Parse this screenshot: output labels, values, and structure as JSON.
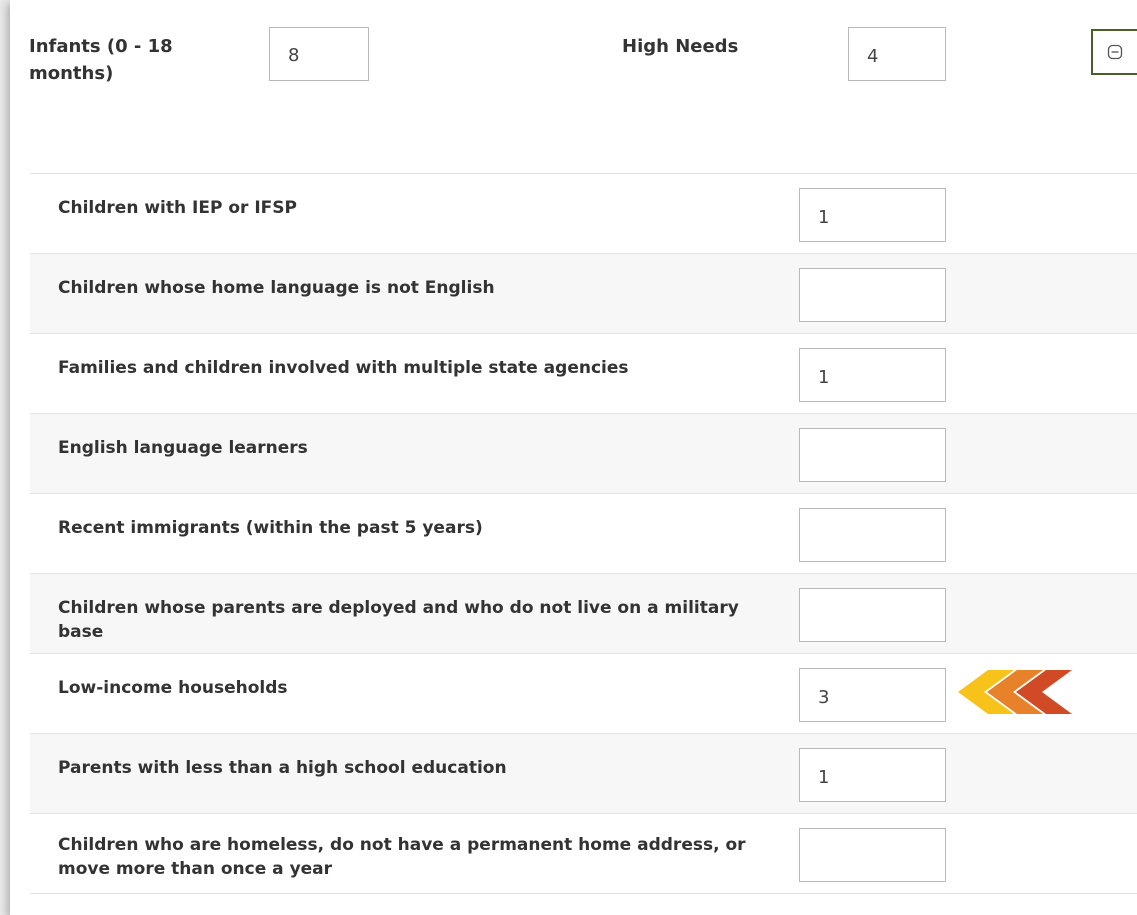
{
  "infants": {
    "label": "Infants (0 - 18 months)",
    "value": "8"
  },
  "high_needs": {
    "label": "High Needs",
    "value": "4"
  },
  "collapse_button": {
    "icon": "minus-square-icon"
  },
  "rows": [
    {
      "label": "Children with IEP or IFSP",
      "value": "1"
    },
    {
      "label": "Children whose home language is not English",
      "value": ""
    },
    {
      "label": "Families and children involved with multiple state agencies",
      "value": "1"
    },
    {
      "label": "English language learners",
      "value": ""
    },
    {
      "label": "Recent immigrants (within the past 5 years)",
      "value": ""
    },
    {
      "label": "Children whose parents are deployed and who do not live on a military base",
      "value": ""
    },
    {
      "label": "Low-income households",
      "value": "3"
    },
    {
      "label": "Parents with less than a high school education",
      "value": "1"
    },
    {
      "label": "Children who are homeless, do not have a permanent home address, or move more than once a year",
      "value": ""
    }
  ],
  "highlight": {
    "icon": "triple-chevron-left-icon",
    "colors": [
      "#f7c21a",
      "#e8822a",
      "#cf4a25"
    ]
  },
  "colors": {
    "button_border": "#4a5e2c",
    "row_alt": "#f7f7f7",
    "border": "#e2e2e2"
  }
}
